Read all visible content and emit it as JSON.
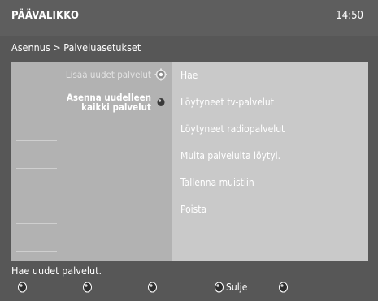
{
  "header": {
    "title": "PÄÄVALIKKO",
    "time": "14:50"
  },
  "breadcrumb": "Asennus > Palveluasetukset",
  "left_menu": [
    {
      "label": "Lisää uudet palvelut",
      "icon": "gear-icon"
    },
    {
      "label": "Asenna uudelleen kaikki palvelut",
      "icon": "dot-icon"
    }
  ],
  "right_options": [
    "Hae",
    "Löytyneet tv-palvelut",
    "Löytyneet radiopalvelut",
    "Muita palveluita löytyi.",
    "Tallenna muistiin",
    "Poista"
  ],
  "status_text": "Hae uudet palvelut.",
  "bottom_buttons": [
    {
      "label": ""
    },
    {
      "label": ""
    },
    {
      "label": ""
    },
    {
      "label": "Sulje"
    },
    {
      "label": ""
    }
  ]
}
